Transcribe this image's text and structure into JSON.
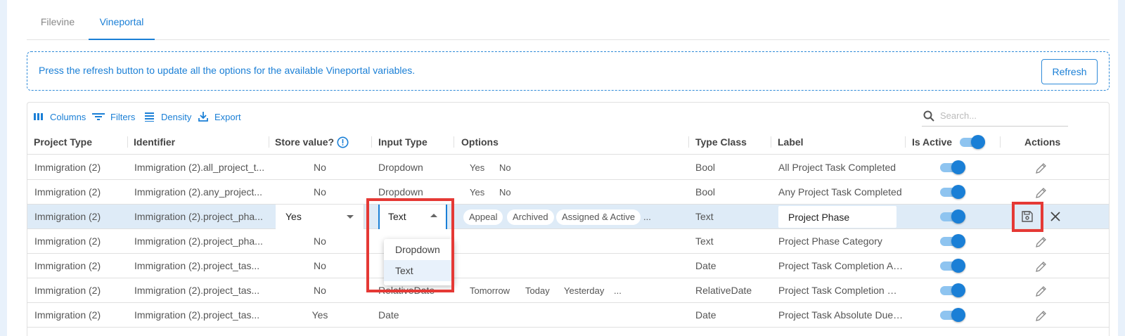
{
  "tabs": [
    {
      "label": "Filevine",
      "active": false
    },
    {
      "label": "Vineportal",
      "active": true
    }
  ],
  "info": {
    "message": "Press the refresh button to update all the options for the available Vineportal variables.",
    "refresh_label": "Refresh"
  },
  "toolbar": {
    "columns_label": "Columns",
    "filters_label": "Filters",
    "density_label": "Density",
    "export_label": "Export",
    "search_placeholder": "Search..."
  },
  "columns": {
    "project_type": "Project Type",
    "identifier": "Identifier",
    "store_value": "Store value?",
    "input_type": "Input Type",
    "options": "Options",
    "type_class": "Type Class",
    "label": "Label",
    "is_active": "Is Active",
    "actions": "Actions"
  },
  "rows": [
    {
      "project_type": "Immigration (2)",
      "identifier": "Immigration (2).all_project_t...",
      "store_value": "No",
      "input_type": "Dropdown",
      "options": [
        "Yes",
        "No"
      ],
      "type_class": "Bool",
      "label": "All Project Task Completed",
      "is_active": true
    },
    {
      "project_type": "Immigration (2)",
      "identifier": "Immigration (2).any_project...",
      "store_value": "No",
      "input_type": "Dropdown",
      "options": [
        "Yes",
        "No"
      ],
      "type_class": "Bool",
      "label": "Any Project Task Completed",
      "is_active": true
    },
    {
      "project_type": "Immigration (2)",
      "identifier": "Immigration (2).project_pha...",
      "store_value": "Yes",
      "input_type": "Text",
      "options": [
        "Appeal",
        "Archived",
        "Assigned & Active",
        "..."
      ],
      "type_class": "Text",
      "label": "Project Phase",
      "is_active": true,
      "editing": true
    },
    {
      "project_type": "Immigration (2)",
      "identifier": "Immigration (2).project_pha...",
      "store_value": "No",
      "input_type": "",
      "options": [],
      "type_class": "Text",
      "label": "Project Phase Category",
      "is_active": true
    },
    {
      "project_type": "Immigration (2)",
      "identifier": "Immigration (2).project_tas...",
      "store_value": "No",
      "input_type": "",
      "options": [],
      "type_class": "Date",
      "label": "Project Task Completion Abs…",
      "is_active": true
    },
    {
      "project_type": "Immigration (2)",
      "identifier": "Immigration (2).project_tas...",
      "store_value": "No",
      "input_type": "RelativeDate",
      "options": [
        "Tomorrow",
        "Today",
        "Yesterday",
        "..."
      ],
      "type_class": "RelativeDate",
      "label": "Project Task Completion Rela…",
      "is_active": true
    },
    {
      "project_type": "Immigration (2)",
      "identifier": "Immigration (2).project_tas...",
      "store_value": "Yes",
      "input_type": "Date",
      "options": [],
      "type_class": "Date",
      "label": "Project Task Absolute Due Da…",
      "is_active": true
    }
  ],
  "input_type_dropdown": {
    "options": [
      "Dropdown",
      "Text"
    ],
    "selected": "Text"
  },
  "colors": {
    "accent": "#1a7fd6",
    "highlight": "#e53935",
    "editing_row": "#deebf7"
  }
}
